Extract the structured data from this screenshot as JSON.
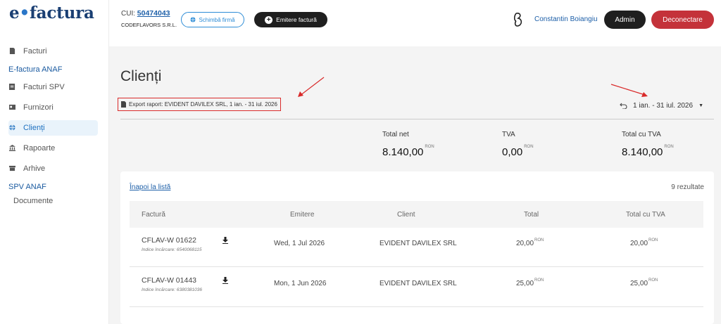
{
  "app": {
    "logo_e": "e",
    "logo_dot": "•",
    "logo_rest": "factura"
  },
  "sidebar": {
    "items": [
      {
        "label": "Facturi",
        "icon": "invoice-icon"
      },
      {
        "label": "Facturi SPV",
        "icon": "invoice-icon"
      },
      {
        "label": "Furnizori",
        "icon": "card-icon"
      },
      {
        "label": "Clienți",
        "icon": "globe-icon"
      },
      {
        "label": "Rapoarte",
        "icon": "bank-icon"
      },
      {
        "label": "Arhive",
        "icon": "archive-icon"
      }
    ],
    "section_anaf": "E-factura ANAF",
    "section_spv": "SPV ANAF",
    "documente": "Documente"
  },
  "header": {
    "cui_label": "CUI:",
    "cui_value": "50474043",
    "company": "CODEFLAVORS S.R.L.",
    "change_company": "Schimbă firmă",
    "issue_invoice": "Emitere factură",
    "user_name": "Constantin Boiangiu",
    "admin": "Admin",
    "logout": "Deconectare"
  },
  "main": {
    "title": "Clienți",
    "export_label": "Export raport: EVIDENT DAVILEX SRL, 1 ian. - 31 iul. 2026",
    "date_range": "1 ian. - 31 iul. 2026",
    "totals": [
      {
        "label": "Total net",
        "value": "8.140,00",
        "currency": "RON"
      },
      {
        "label": "TVA",
        "value": "0,00",
        "currency": "RON"
      },
      {
        "label": "Total cu TVA",
        "value": "8.140,00",
        "currency": "RON"
      }
    ],
    "back_link": "Înapoi la listă",
    "results": "9 rezultate",
    "columns": [
      "Factură",
      "Emitere",
      "Client",
      "Total",
      "Total cu TVA"
    ],
    "rows": [
      {
        "invoice": "CFLAV-W 01622",
        "index": "Indice încărcare: 6540068115",
        "date": "Wed, 1 Jul 2026",
        "client": "EVIDENT DAVILEX SRL",
        "total": "20,00",
        "total_tva": "20,00",
        "currency": "RON"
      },
      {
        "invoice": "CFLAV-W 01443",
        "index": "Indice încărcare: 6380381036",
        "date": "Mon, 1 Jun 2026",
        "client": "EVIDENT DAVILEX SRL",
        "total": "25,00",
        "total_tva": "25,00",
        "currency": "RON"
      }
    ]
  },
  "colors": {
    "accent": "#1d5fa8",
    "logout": "#c4323a",
    "dark": "#1f1f1f",
    "annotation": "#d92a2a"
  }
}
